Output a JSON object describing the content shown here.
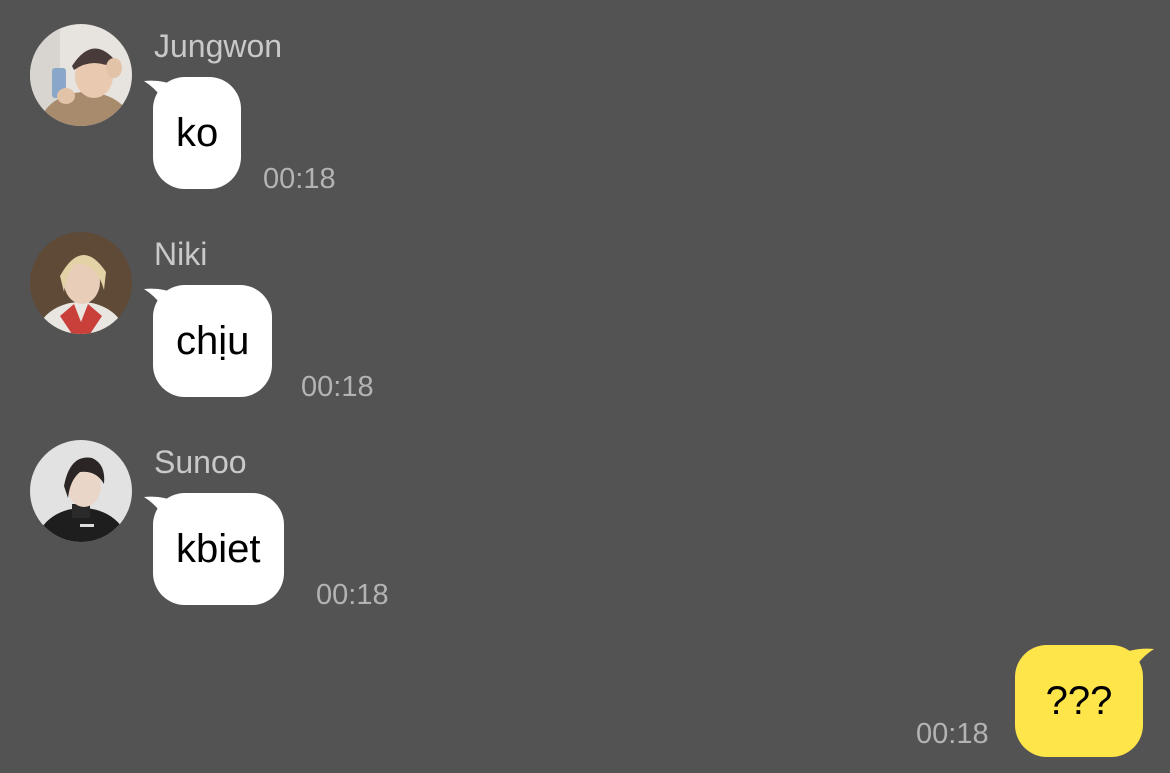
{
  "messages": [
    {
      "sender": "Jungwon",
      "text": "ko",
      "time": "00:18",
      "avatar": "avatar-photo-beanie"
    },
    {
      "sender": "Niki",
      "text": "chịu",
      "time": "00:18",
      "avatar": "avatar-photo-blonde"
    },
    {
      "sender": "Sunoo",
      "text": "kbiet",
      "time": "00:18",
      "avatar": "avatar-photo-dark-jacket"
    }
  ],
  "my_message": {
    "text": "???",
    "time": "00:18"
  },
  "colors": {
    "background": "#545354",
    "incoming_bubble": "#ffffff",
    "outgoing_bubble": "#fee54a",
    "sender_name": "#c9c9c9",
    "timestamp": "#b3b3b3"
  }
}
